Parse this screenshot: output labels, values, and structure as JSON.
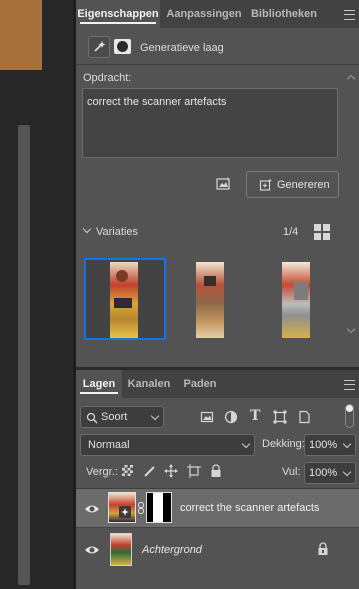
{
  "properties_panel": {
    "tabs": [
      "Eigenschappen",
      "Aanpassingen",
      "Bibliotheken"
    ],
    "active_tab": "Eigenschappen",
    "layer_type_label": "Generatieve laag",
    "prompt_label": "Opdracht:",
    "prompt_value": "correct the scanner artefacts",
    "generate_label": "Genereren",
    "variations_label": "Variaties",
    "variation_count": "1/4",
    "selected_variation": 1
  },
  "layers_panel": {
    "tabs": [
      "Lagen",
      "Kanalen",
      "Paden"
    ],
    "active_tab": "Lagen",
    "filter_label": "Soort",
    "blend_mode": "Normaal",
    "opacity_label": "Dekking:",
    "opacity_value": "100%",
    "lock_label": "Vergr.:",
    "fill_label": "Vul:",
    "fill_value": "100%",
    "layers": [
      {
        "name": "correct the scanner artefacts",
        "italic": false,
        "selected": true,
        "visible": true
      },
      {
        "name": "Achtergrond",
        "italic": true,
        "selected": false,
        "visible": true,
        "locked": true
      }
    ]
  },
  "colors": {
    "accent_selection": "#1473e6",
    "panel_bg": "#535353",
    "canvas_doc": "#a8703c"
  }
}
